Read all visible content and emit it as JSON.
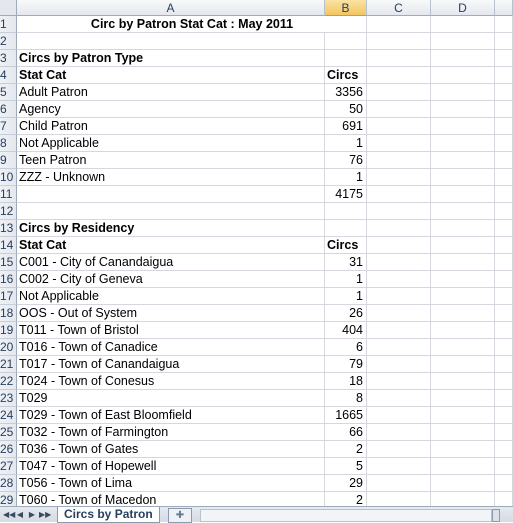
{
  "columns": [
    "A",
    "B",
    "C",
    "D"
  ],
  "selected_column": "B",
  "rows": [
    {
      "n": "1",
      "a": "Circ by Patron Stat Cat : May 2011",
      "b": "",
      "style": "title"
    },
    {
      "n": "2",
      "a": "",
      "b": ""
    },
    {
      "n": "3",
      "a": "Circs by Patron Type",
      "b": "",
      "style": "section"
    },
    {
      "n": "4",
      "a": "Stat Cat",
      "b": "Circs",
      "style": "header"
    },
    {
      "n": "5",
      "a": "Adult Patron",
      "b": "3356"
    },
    {
      "n": "6",
      "a": "Agency",
      "b": "50"
    },
    {
      "n": "7",
      "a": "Child Patron",
      "b": "691"
    },
    {
      "n": "8",
      "a": "Not Applicable",
      "b": "1"
    },
    {
      "n": "9",
      "a": "Teen Patron",
      "b": "76"
    },
    {
      "n": "10",
      "a": "ZZZ - Unknown",
      "b": "1"
    },
    {
      "n": "11",
      "a": "",
      "b": "4175"
    },
    {
      "n": "12",
      "a": "",
      "b": ""
    },
    {
      "n": "13",
      "a": "Circs by Residency",
      "b": "",
      "style": "section"
    },
    {
      "n": "14",
      "a": "Stat Cat",
      "b": "Circs",
      "style": "header"
    },
    {
      "n": "15",
      "a": "C001 - City of Canandaigua",
      "b": "31"
    },
    {
      "n": "16",
      "a": "C002 - City of Geneva",
      "b": "1"
    },
    {
      "n": "17",
      "a": "Not Applicable",
      "b": "1"
    },
    {
      "n": "18",
      "a": "OOS - Out of System",
      "b": "26"
    },
    {
      "n": "19",
      "a": "T011 - Town of Bristol",
      "b": "404"
    },
    {
      "n": "20",
      "a": "T016 - Town of Canadice",
      "b": "6"
    },
    {
      "n": "21",
      "a": "T017 - Town of Canandaigua",
      "b": "79"
    },
    {
      "n": "22",
      "a": "T024 - Town of Conesus",
      "b": "18"
    },
    {
      "n": "23",
      "a": "T029",
      "b": "8"
    },
    {
      "n": "24",
      "a": "T029 - Town of East Bloomfield",
      "b": "1665"
    },
    {
      "n": "25",
      "a": "T032 - Town of Farmington",
      "b": "66"
    },
    {
      "n": "26",
      "a": "T036 - Town of Gates",
      "b": "2"
    },
    {
      "n": "27",
      "a": "T047 - Town of Hopewell",
      "b": "5"
    },
    {
      "n": "28",
      "a": "T056 - Town of Lima",
      "b": "29"
    },
    {
      "n": "29",
      "a": "T060 - Town of Macedon",
      "b": "2"
    }
  ],
  "sheet_tab": "Circs by Patron",
  "nav_buttons": [
    "◀◀",
    "◀",
    "▶",
    "▶▶"
  ]
}
